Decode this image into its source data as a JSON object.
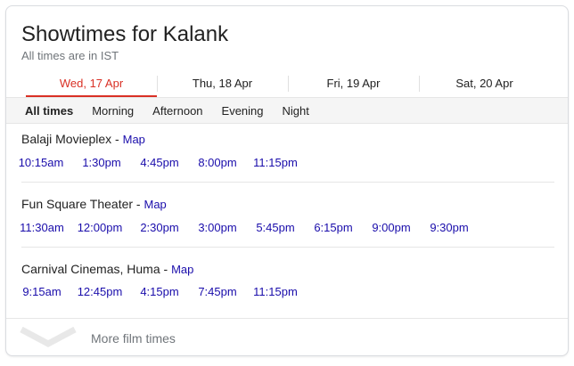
{
  "header": {
    "title": "Showtimes for Kalank",
    "subtitle": "All times are in IST"
  },
  "date_tabs": [
    {
      "label": "Wed, 17 Apr",
      "active": true
    },
    {
      "label": "Thu, 18 Apr",
      "active": false
    },
    {
      "label": "Fri, 19 Apr",
      "active": false
    },
    {
      "label": "Sat, 20 Apr",
      "active": false
    }
  ],
  "filters": [
    {
      "label": "All times",
      "active": true
    },
    {
      "label": "Morning",
      "active": false
    },
    {
      "label": "Afternoon",
      "active": false
    },
    {
      "label": "Evening",
      "active": false
    },
    {
      "label": "Night",
      "active": false
    }
  ],
  "theaters": [
    {
      "name": "Balaji Movieplex",
      "separator": " - ",
      "map_label": "Map",
      "times": [
        "10:15am",
        "1:30pm",
        "4:45pm",
        "8:00pm",
        "11:15pm"
      ]
    },
    {
      "name": "Fun Square Theater",
      "separator": " - ",
      "map_label": "Map",
      "times": [
        "11:30am",
        "12:00pm",
        "2:30pm",
        "3:00pm",
        "5:45pm",
        "6:15pm",
        "9:00pm",
        "9:30pm"
      ]
    },
    {
      "name": "Carnival Cinemas, Huma",
      "separator": " - ",
      "map_label": "Map",
      "times": [
        "9:15am",
        "12:45pm",
        "4:15pm",
        "7:45pm",
        "11:15pm"
      ]
    }
  ],
  "more": {
    "label": "More film times"
  },
  "colors": {
    "accent": "#d93025",
    "link": "#1a0dab",
    "muted": "#70757a"
  }
}
